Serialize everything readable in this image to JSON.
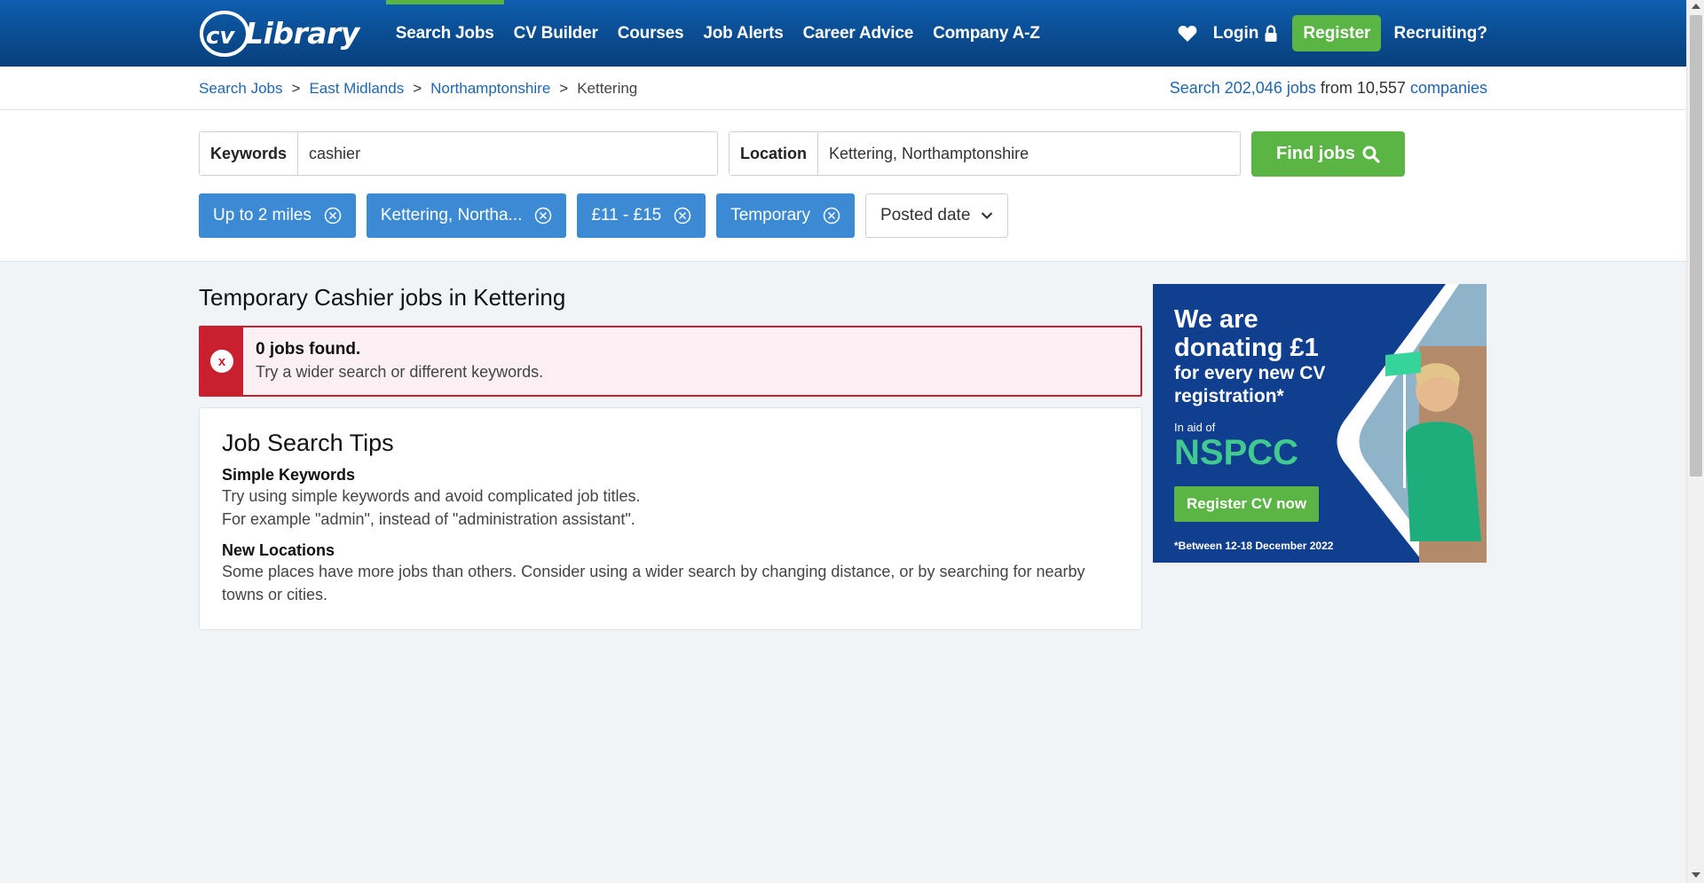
{
  "header": {
    "logo_text": "Library",
    "logo_mark": "cv",
    "nav": [
      "Search Jobs",
      "CV Builder",
      "Courses",
      "Job Alerts",
      "Career Advice",
      "Company A-Z"
    ],
    "login": "Login",
    "register": "Register",
    "recruiting": "Recruiting?"
  },
  "breadcrumb": {
    "items": [
      "Search Jobs",
      "East Midlands",
      "Northamptonshire"
    ],
    "current": "Kettering",
    "sep": ">"
  },
  "stats": {
    "prefix": "Search",
    "jobs": "202,046 jobs",
    "mid": "from 10,557",
    "companies": "companies"
  },
  "search": {
    "keywords_label": "Keywords",
    "keywords_value": "cashier",
    "location_label": "Location",
    "location_value": "Kettering, Northamptonshire",
    "find_label": "Find jobs"
  },
  "filters": {
    "chips": [
      "Up to 2 miles",
      "Kettering, Northa...",
      "£11 - £15",
      "Temporary"
    ],
    "posted_date": "Posted date"
  },
  "results": {
    "title": "Temporary Cashier jobs in Kettering",
    "alert_title": "0 jobs found.",
    "alert_text": "Try a wider search or different keywords."
  },
  "tips": {
    "title": "Job Search Tips",
    "simple_head": "Simple Keywords",
    "simple_line1": "Try using simple keywords and avoid complicated job titles.",
    "simple_line2": "For example \"admin\", instead of \"administration assistant\".",
    "loc_head": "New Locations",
    "loc_line1": "Some places have more jobs than others. Consider using a wider search by changing distance, or by searching for nearby",
    "loc_line2": "towns or cities."
  },
  "ad": {
    "line1": "We are",
    "line2": "donating £1",
    "line3": "for every new CV",
    "line4": "registration*",
    "aid": "In aid of",
    "nspcc": "NSPCC",
    "button": "Register CV now",
    "footnote": "*Between 12-18 December 2022"
  },
  "colors": {
    "header_blue": "#0a4a8e",
    "accent_green": "#5bb545",
    "link_blue": "#1f66b1",
    "chip_blue": "#3d8ad4",
    "alert_red": "#c8202e"
  }
}
